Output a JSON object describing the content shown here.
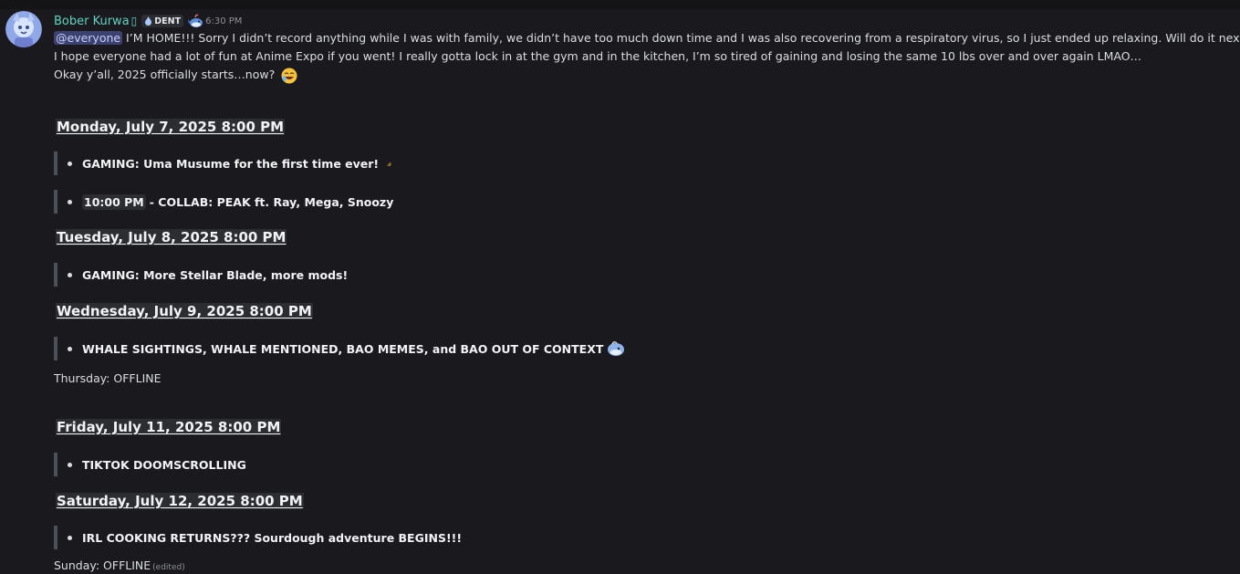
{
  "message": {
    "author": {
      "username": "Bober Kurwa",
      "username_glyph": "▯",
      "tag": "DENT",
      "timestamp": "6:30 PM"
    },
    "intro": {
      "mention": "@everyone",
      "line1_rest": " I’M HOME!!! Sorry I didn’t record anything while I was with family, we didn’t have too much down time and I was also recovering from a respiratory virus, so I just ended up relaxing. Will do it next month!",
      "line2": "I hope everyone had a lot of fun at Anime Expo if you went! I really gotta lock in at the gym and in the kitchen, I’m so tired of gaining and losing the same 10 lbs over and over again LMAO…",
      "line3": "Okay y’all, 2025 officially starts…now?"
    },
    "schedule": {
      "monday": {
        "heading": "Monday, July 7, 2025 8:00 PM",
        "item1": "GAMING: Uma Musume for the first time ever!",
        "item2_time": "10:00 PM",
        "item2_text": " - COLLAB: PEAK ft. Ray, Mega, Snoozy"
      },
      "tuesday": {
        "heading": "Tuesday, July 8, 2025 8:00 PM",
        "item1": "GAMING: More Stellar Blade, more mods!"
      },
      "wednesday": {
        "heading": "Wednesday, July 9, 2025 8:00 PM",
        "item1": "WHALE SIGHTINGS, WHALE MENTIONED, BAO MEMES, and BAO OUT OF CONTEXT"
      },
      "thursday": "Thursday: OFFLINE",
      "friday": {
        "heading": "Friday, July 11, 2025 8:00 PM",
        "item1": "TIKTOK DOOMSCROLLING"
      },
      "saturday": {
        "heading": "Saturday, July 12, 2025 8:00 PM",
        "item1": "IRL COOKING RETURNS??? Sourdough adventure BEGINS!!!"
      },
      "sunday": "Sunday: OFFLINE",
      "edited_label": "(edited)"
    }
  },
  "colors": {
    "background": "#1a1a1e",
    "username": "#5fd3c1",
    "mention_bg": "#3c4270",
    "quote_bar": "#4e5058"
  },
  "icons": {
    "tag_icon": "flame-icon",
    "role_icon": "whale-icon",
    "emoji_intro": "laughing-face-emoji",
    "emoji_monday": "horse-emoji",
    "emoji_wednesday": "whale-emoji"
  }
}
